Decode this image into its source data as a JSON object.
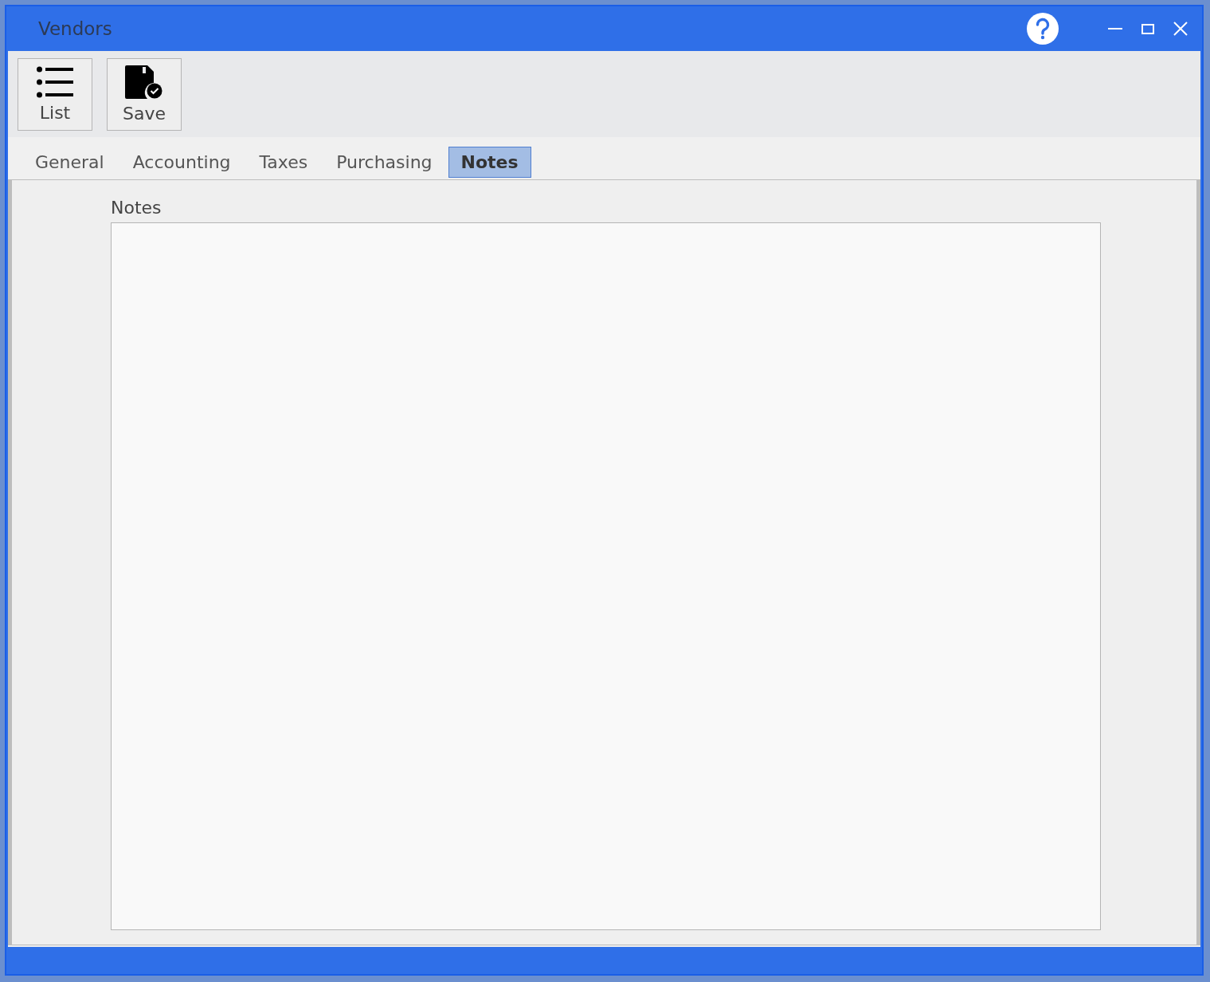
{
  "window": {
    "title": "Vendors"
  },
  "toolbar": [
    {
      "label": "List",
      "kind": "list"
    },
    {
      "label": "Save",
      "kind": "save"
    }
  ],
  "tabs": [
    {
      "label": "General",
      "selected": false
    },
    {
      "label": "Accounting",
      "selected": false
    },
    {
      "label": "Taxes",
      "selected": false
    },
    {
      "label": "Purchasing",
      "selected": false
    },
    {
      "label": "Notes",
      "selected": true
    }
  ],
  "notes": {
    "label": "Notes"
  }
}
